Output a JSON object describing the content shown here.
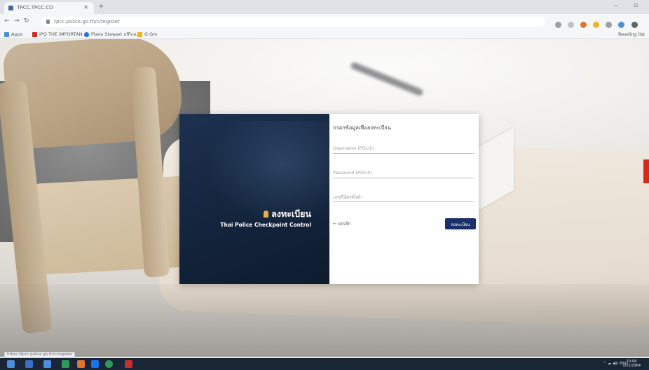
{
  "browser": {
    "tab_title": "TPCC.TPCC.CO",
    "url": "tpcc.police.go.th/c/register",
    "bookmarks": [
      "Apps",
      "IPO THE IMPORTAN...",
      "Plans Stewart office...",
      "G Gm"
    ],
    "reading_list": "Reading list"
  },
  "card": {
    "brand_title": "ลงทะเบียน",
    "brand_subtitle": "Thai Police Checkpoint Control",
    "form_title": "กรอกข้อมูลเพื่อลงทะเบียน",
    "username_placeholder": "Username (POLIS)",
    "password_placeholder": "Password (POLIS)",
    "code_placeholder": "เลขที่บัตรตั๋วตำ",
    "back_label": "← ยกเลิก",
    "submit_label": "ลงทะเบียน"
  },
  "status_url": "https://tpcc.police.go.th/c/register",
  "taskbar": {
    "tray_text": "^ ☁ ◀)) ENG",
    "time": "10:06",
    "date": "1/12/2564"
  },
  "colors": {
    "brand_panel": "#15263f",
    "submit_button": "#1c2f6b",
    "accent_red": "#d9261f",
    "lamp": "#e8b04a"
  },
  "icons": [
    "back-icon",
    "forward-icon",
    "reload-icon",
    "lock-icon",
    "star-icon",
    "lamp-icon",
    "windows-icon"
  ]
}
